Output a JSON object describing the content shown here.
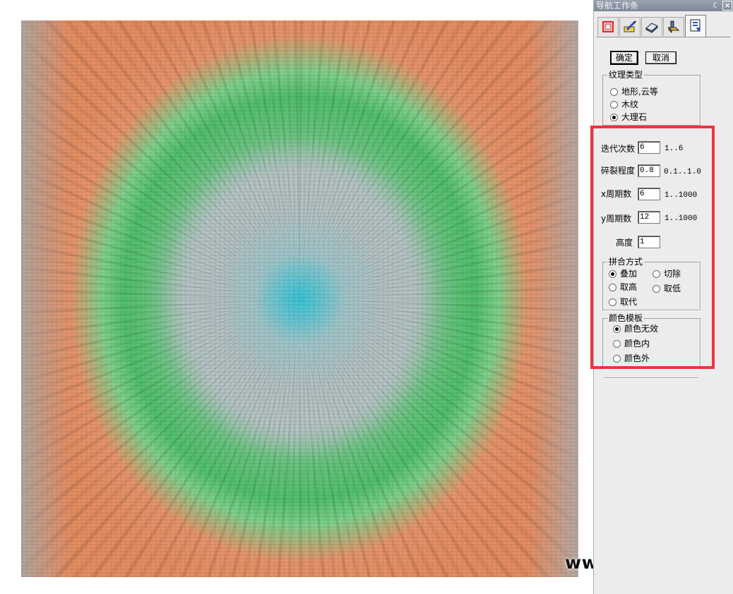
{
  "panel": {
    "title": "导航工作条",
    "pin_glyph": "☾",
    "close_glyph": "×",
    "tabs": [
      {
        "icon": "frame-icon",
        "active": false
      },
      {
        "icon": "pencil-paint-icon",
        "active": false
      },
      {
        "icon": "surface-layer-icon",
        "active": false
      },
      {
        "icon": "tool-icon",
        "active": false
      },
      {
        "icon": "document-export-icon",
        "active": true
      }
    ],
    "ok_label": "确定",
    "cancel_label": "取消"
  },
  "texture_type": {
    "legend": "纹理类型",
    "options": [
      "地形,云等",
      "木纹",
      "大理石"
    ],
    "selected": "大理石"
  },
  "params": {
    "iterations": {
      "label": "迭代次数",
      "value": "6",
      "range": "1..6"
    },
    "fracture": {
      "label": "碎裂程度",
      "value": "0.8",
      "range": "0.1..1.0"
    },
    "x_period": {
      "label": "x周期数",
      "value": "6",
      "range": "1..1000"
    },
    "y_period": {
      "label": "y周期数",
      "value": "12",
      "range": "1..1000"
    },
    "height": {
      "label": "高度",
      "value": "1"
    }
  },
  "blend_mode": {
    "legend": "拼合方式",
    "options": [
      "叠加",
      "切除",
      "取高",
      "取低",
      "取代"
    ],
    "selected": "叠加"
  },
  "color_template": {
    "legend": "颜色模板",
    "options": [
      "颜色无效",
      "颜色内",
      "颜色外"
    ],
    "selected": "颜色无效"
  },
  "watermark": "www.rjtj.cn软荐网",
  "colors": {
    "highlight": "#ee3340",
    "panel_bg": "#ececec",
    "titlebar": "#8a93a3"
  }
}
